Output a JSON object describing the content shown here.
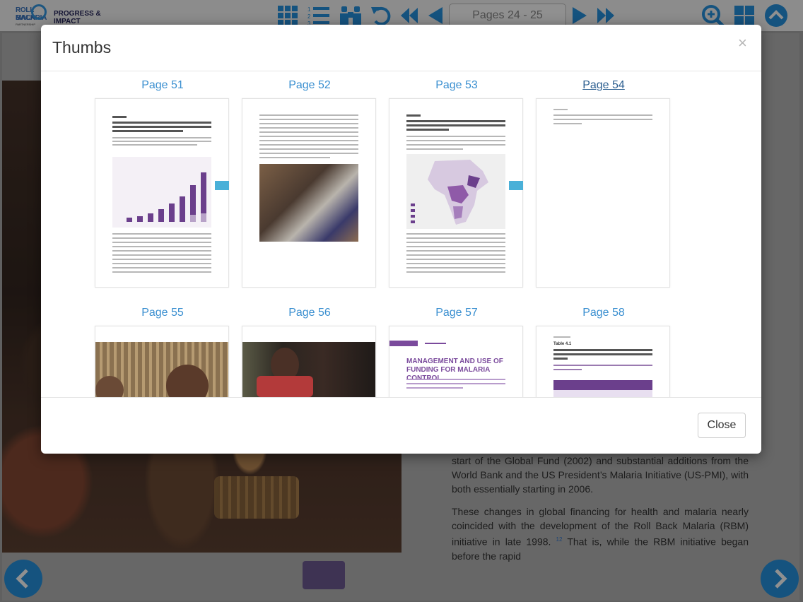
{
  "toolbar": {
    "logo": {
      "line1": "ROLL BACK",
      "line2": "MALARIA",
      "line3": "PARTNERSHIP",
      "series": "PROGRESS &",
      "series2": "IMPACT SERIES"
    },
    "icons": [
      "grid-icon",
      "list-icon",
      "binoculars-icon",
      "undo-icon",
      "first-page-icon",
      "previous-page-icon",
      "next-page-icon",
      "last-page-icon",
      "zoom-icon",
      "thumbnails-icon",
      "collapse-up-icon"
    ],
    "pages_label": "Pages 24 - 25"
  },
  "background_page": {
    "paragraph1": "start of the Global Fund (2002) and substantial additions from the World Bank and the US President’s Malaria Initiative (US-PMI), with both essentially starting in 2006.",
    "paragraph2_a": "These changes in global financing for health and malaria nearly coincided with the development of the Roll Back Malaria (RBM) initiative in late 1998.",
    "paragraph2_ref": "12",
    "paragraph2_b": "That is, while the RBM initiative began before the rapid"
  },
  "modal": {
    "title": "Thumbs",
    "close_x": "×",
    "close_label": "Close",
    "thumbs": [
      {
        "label": "Page 51"
      },
      {
        "label": "Page 52"
      },
      {
        "label": "Page 53"
      },
      {
        "label": "Page 54"
      },
      {
        "label": "Page 55"
      },
      {
        "label": "Page 56"
      },
      {
        "label": "Page 57"
      },
      {
        "label": "Page 58"
      }
    ],
    "page57_heading": "MANAGEMENT AND USE OF FUNDING FOR MALARIA CONTROL",
    "page58_table": "Table 4.1"
  },
  "colors": {
    "accent": "#3a8fd0",
    "toolbar_icons": "#1f77b6",
    "purple": "#7a4a9c"
  }
}
